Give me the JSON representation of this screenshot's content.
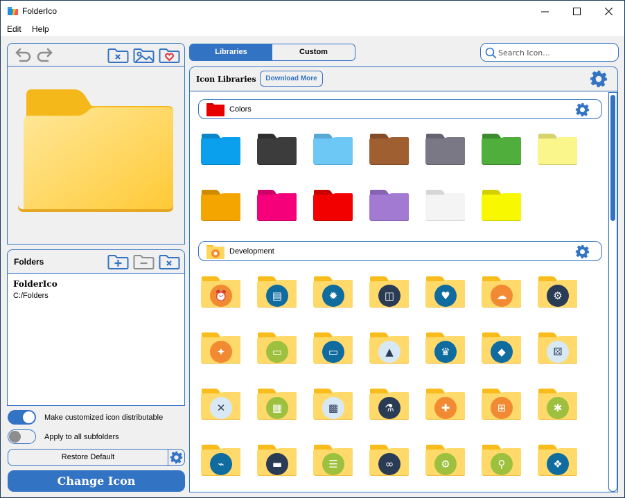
{
  "window": {
    "title": "FolderIco",
    "controls": [
      "minimize",
      "maximize",
      "close"
    ]
  },
  "menu": [
    "Edit",
    "Help"
  ],
  "preview": {
    "toolbar": {
      "undo": "undo-icon",
      "redo": "redo-icon",
      "remove_icon": "folder-remove-icon",
      "image_icon": "folder-image-icon",
      "favorite_icon": "folder-heart-icon"
    },
    "folder_color": "#ffd75e"
  },
  "folders": {
    "title": "Folders",
    "items": [
      {
        "name": "FolderIco",
        "path": "C:/Folders"
      }
    ]
  },
  "options": {
    "distributable": {
      "label": "Make customized icon distributable",
      "on": true
    },
    "subfolders": {
      "label": "Apply to all subfolders",
      "on": false
    }
  },
  "buttons": {
    "restore": "Restore Default",
    "change": "Change Icon"
  },
  "tabs": [
    {
      "label": "Libraries",
      "active": true
    },
    {
      "label": "Custom",
      "active": false
    }
  ],
  "search": {
    "placeholder": "Search Icon...",
    "value": ""
  },
  "library": {
    "title": "Icon Libraries",
    "download_label": "Download More",
    "sections": [
      {
        "label": "Colors",
        "icons": [
          {
            "name": "blue",
            "color": "#0aa0ee",
            "tab": "#0a86c9"
          },
          {
            "name": "black",
            "color": "#3c3c3c",
            "tab": "#2e2e2e"
          },
          {
            "name": "light-blue",
            "color": "#6ec8f5",
            "tab": "#58a9d6"
          },
          {
            "name": "brown",
            "color": "#a05f30",
            "tab": "#844c26"
          },
          {
            "name": "gray",
            "color": "#7b7886",
            "tab": "#656370"
          },
          {
            "name": "green",
            "color": "#4fae3c",
            "tab": "#3c8c2e"
          },
          {
            "name": "light-yellow",
            "color": "#fbf68c",
            "tab": "#d8d26a"
          },
          {
            "name": "orange",
            "color": "#f5a500",
            "tab": "#cf8a00"
          },
          {
            "name": "pink",
            "color": "#f5007a",
            "tab": "#cc0066"
          },
          {
            "name": "red",
            "color": "#f20000",
            "tab": "#c80000"
          },
          {
            "name": "purple",
            "color": "#a27ad2",
            "tab": "#8862b3"
          },
          {
            "name": "white",
            "color": "#f4f4f4",
            "tab": "#d6d6d6"
          },
          {
            "name": "yellow",
            "color": "#f8f800",
            "tab": "#d4d000"
          }
        ]
      },
      {
        "label": "Development",
        "icons": [
          {
            "name": "alarm-clock",
            "badge": "#f18a32",
            "glyph": "⏰"
          },
          {
            "name": "printer-tools",
            "badge": "#106b9e",
            "glyph": "▤"
          },
          {
            "name": "atom",
            "badge": "#106b9e",
            "glyph": "✹"
          },
          {
            "name": "browser-gauge",
            "badge": "#2a3b55",
            "glyph": "◫"
          },
          {
            "name": "playing-cards",
            "badge": "#106b9e",
            "glyph": "♥"
          },
          {
            "name": "cloud",
            "badge": "#f18a32",
            "glyph": "☁"
          },
          {
            "name": "gears",
            "badge": "#2a3b55",
            "glyph": "⚙"
          },
          {
            "name": "compass",
            "badge": "#f18a32",
            "glyph": "✦"
          },
          {
            "name": "monitor-code",
            "badge": "#9dc03f",
            "glyph": "▭"
          },
          {
            "name": "monitor-link",
            "badge": "#106b9e",
            "glyph": "▭"
          },
          {
            "name": "traffic-cone",
            "badge": "#d8e9f5",
            "glyph": "▲"
          },
          {
            "name": "crown",
            "badge": "#106b9e",
            "glyph": "♛"
          },
          {
            "name": "diamond",
            "badge": "#106b9e",
            "glyph": "◆"
          },
          {
            "name": "dice",
            "badge": "#d8e9f5",
            "glyph": "⚄"
          },
          {
            "name": "ruler-pencil",
            "badge": "#d8e9f5",
            "glyph": "✕"
          },
          {
            "name": "pixel-document",
            "badge": "#9dc03f",
            "glyph": "▦"
          },
          {
            "name": "firewall",
            "badge": "#d8e9f5",
            "glyph": "▩"
          },
          {
            "name": "flask",
            "badge": "#2a3b55",
            "glyph": "⚗"
          },
          {
            "name": "gamepad",
            "badge": "#f18a32",
            "glyph": "✚"
          },
          {
            "name": "sitemap",
            "badge": "#f18a32",
            "glyph": "⊞"
          },
          {
            "name": "bug",
            "badge": "#9dc03f",
            "glyph": "✱"
          },
          {
            "name": "chart-laptop",
            "badge": "#106b9e",
            "glyph": "⌁"
          },
          {
            "name": "windows",
            "badge": "#2a3b55",
            "glyph": "▬"
          },
          {
            "name": "sliders",
            "badge": "#9dc03f",
            "glyph": "☰"
          },
          {
            "name": "link",
            "badge": "#2a3b55",
            "glyph": "∞"
          },
          {
            "name": "gear-search",
            "badge": "#9dc03f",
            "glyph": "⚙"
          },
          {
            "name": "microscope",
            "badge": "#9dc03f",
            "glyph": "⚲"
          },
          {
            "name": "dropbox",
            "badge": "#106b9e",
            "glyph": "❖"
          }
        ]
      }
    ]
  },
  "colors": {
    "accent": "#3373c4",
    "folder_yellow": "#ffd75e",
    "folder_yellow_tab": "#f8bd1c"
  }
}
